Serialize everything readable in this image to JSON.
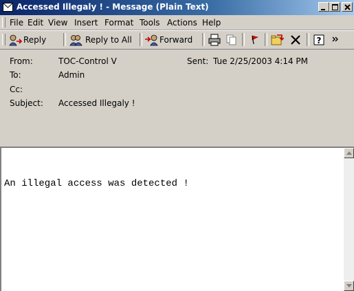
{
  "window": {
    "title": "Accessed Illegaly ! - Message (Plain Text)",
    "title_color": "#0a246a"
  },
  "menu": {
    "file": "File",
    "edit": "Edit",
    "view": "View",
    "insert": "Insert",
    "format": "Format",
    "tools": "Tools",
    "actions": "Actions",
    "help": "Help"
  },
  "toolbar": {
    "reply": "Reply",
    "reply_all": "Reply to All",
    "forward": "Forward",
    "icons": [
      "print-icon",
      "copy-icon",
      "flag-icon",
      "move-to-folder-icon",
      "delete-icon",
      "help-icon"
    ]
  },
  "header": {
    "from_label": "From:",
    "from_value": "TOC-Control V",
    "sent_label": "Sent:",
    "sent_value": "Tue 2/25/2003 4:14 PM",
    "to_label": "To:",
    "to_value": "Admin",
    "cc_label": "Cc:",
    "cc_value": "",
    "subject_label": "Subject:",
    "subject_value": "Accessed Illegaly !"
  },
  "body": {
    "text": "An illegal access was detected !"
  }
}
